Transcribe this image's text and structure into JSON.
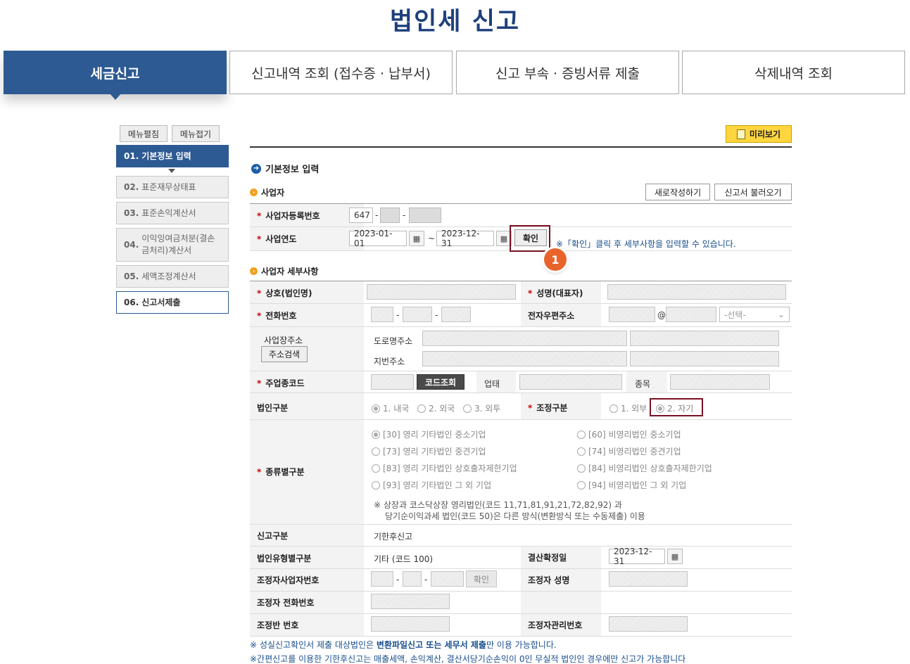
{
  "page_title": "법인세 신고",
  "main_tabs": [
    {
      "label": "세금신고",
      "active": true
    },
    {
      "label": "신고내역 조회 (접수증 · 납부서)",
      "active": false
    },
    {
      "label": "신고 부속 · 증빙서류 제출",
      "active": false
    },
    {
      "label": "삭제내역 조회",
      "active": false
    }
  ],
  "sidebar": {
    "expand_label": "메뉴펼침",
    "collapse_label": "메뉴접기",
    "items": [
      {
        "num": "01.",
        "label": "기본정보 입력"
      },
      {
        "num": "02.",
        "label": "표준재무상태표"
      },
      {
        "num": "03.",
        "label": "표준손익계산서"
      },
      {
        "num": "04.",
        "label": "이익잉여금처분(결손금처리)계산서"
      },
      {
        "num": "05.",
        "label": "세액조정계산서"
      },
      {
        "num": "06.",
        "label": "신고서제출"
      }
    ]
  },
  "preview_label": "미리보기",
  "section": {
    "title": "기본정보 입력",
    "business_title": "사업자",
    "new_write_label": "새로작성하기",
    "load_label": "신고서 불러오기",
    "brn_label": "사업자등록번호",
    "brn_prefix": "647",
    "year_label": "사업연도",
    "start_date": "2023-01-01",
    "end_date": "2023-12-31",
    "tilde": "~",
    "confirm_label": "확인",
    "confirm_hint": "※「확인」클릭 후 세부사항을 입력할 수 있습니다.",
    "badge": "1"
  },
  "details": {
    "title": "사업자 세부사항",
    "company_name_label": "상호(법인명)",
    "ceo_label": "성명(대표자)",
    "phone_label": "전화번호",
    "email_label": "전자우편주소",
    "email_at": "@",
    "email_select": "-선택-",
    "addr_label": "사업장주소",
    "addr_search_label": "주소검색",
    "road_addr_label": "도로명주소",
    "lot_addr_label": "지번주소",
    "industry_code_label": "주업종코드",
    "code_lookup_label": "코드조회",
    "business_type_label": "업태",
    "item_label": "종목",
    "corp_type_label": "법인구분",
    "corp_types": [
      "1. 내국",
      "2. 외국",
      "3. 외투"
    ],
    "adjust_type_label": "조정구분",
    "adjust_types": [
      "1. 외부",
      "2. 자기"
    ],
    "category_label": "종류별구분",
    "categories_left": [
      "[30] 영리 기타법인 중소기업",
      "[73] 영리 기타법인 중견기업",
      "[83] 영리 기타법인 상호출자제한기업",
      "[93] 영리 기타법인 그 외 기업"
    ],
    "categories_right": [
      "[60] 비영리법인 중소기업",
      "[74] 비영리법인 중견기업",
      "[84] 비영리법인 상호출자제한기업",
      "[94] 비영리법인 그 외 기업"
    ],
    "category_note_1": "※ 상장과 코스닥상장 영리법인(코드 11,71,81,91,21,72,82,92) 과",
    "category_note_2": "당기순이익과세 법인(코드 50)은 다른 방식(변환방식 또는 수동제출) 이용",
    "report_type_label": "신고구분",
    "report_type_value": "기한후신고",
    "corp_form_label": "법인유형별구분",
    "corp_form_value": "기타 (코드 100)",
    "settle_date_label": "결산확정일",
    "settle_date_value": "2023-12-31",
    "adjuster_brn_label": "조정자사업자번호",
    "adjuster_confirm_label": "확인",
    "adjuster_name_label": "조정자 성명",
    "adjuster_phone_label": "조정자 전화번호",
    "adjust_team_label": "조정반 번호",
    "adjuster_mgmt_label": "조정자관리번호"
  },
  "footer": {
    "note1_pre": "※ 성실신고확인서 제출 대상법인은 ",
    "note1_bold": "변환파일신고 또는 세무서 제출",
    "note1_post": "만 이용 가능합니다.",
    "note2": "※간편신고를 이용한 기한후신고는 매출세액, 손익계산, 결산서당기순손익이 0인 무실적 법인인 경우에만 신고가 가능합니다"
  },
  "colors": {
    "primary": "#2d5a92",
    "title": "#1d3f7c",
    "accent": "#ffd640",
    "badge": "#e8642a",
    "highlight": "#7a1022"
  }
}
